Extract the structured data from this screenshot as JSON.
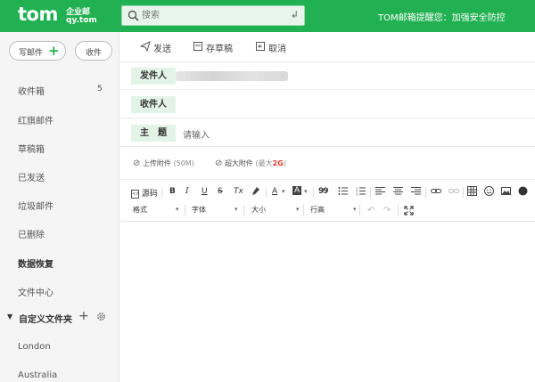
{
  "header": {
    "logo_main": "tom",
    "logo_sub1": "企业邮",
    "logo_sub2": "qy.tom",
    "search_placeholder": "搜索",
    "search_enter_glyph": "↲",
    "notice": "TOM邮箱提醒您：加强安全防控"
  },
  "sidebar": {
    "compose_label": "写邮件",
    "compose_plus": "+",
    "receive_label": "收件",
    "items": [
      {
        "label": "收件箱",
        "count": "5"
      },
      {
        "label": "红旗邮件"
      },
      {
        "label": "草稿箱"
      },
      {
        "label": "已发送"
      },
      {
        "label": "垃圾邮件"
      },
      {
        "label": "已删除"
      },
      {
        "label": "数据恢复"
      },
      {
        "label": "文件中心"
      }
    ],
    "custom_folder": {
      "label": "自定义文件夹",
      "triangle": "▼",
      "plus": "+"
    },
    "folders": [
      "London",
      "Australia"
    ]
  },
  "toolbar": {
    "send": "发送",
    "save_draft": "存草稿",
    "cancel": "取消"
  },
  "form": {
    "sender_label": "发件人",
    "recipient_label": "收件人",
    "subject_label": "主　题",
    "subject_placeholder": "请输入"
  },
  "attachments": {
    "clip": "⊘",
    "upload": "上传附件",
    "upload_limit": "(50M)",
    "big": "超大附件",
    "big_note_prefix": "(最大",
    "big_size": "2G",
    "big_note_suffix": ")"
  },
  "editor": {
    "source": "源码",
    "bold": "B",
    "italic": "I",
    "underline": "U",
    "strike": "S",
    "clear_format": "Tx",
    "font_color": "A",
    "bg_color": "A",
    "quote": "99",
    "format_label": "格式",
    "font_label": "字体",
    "size_label": "大小",
    "lineheight_label": "行高",
    "dropdown_arrow": "▾"
  }
}
